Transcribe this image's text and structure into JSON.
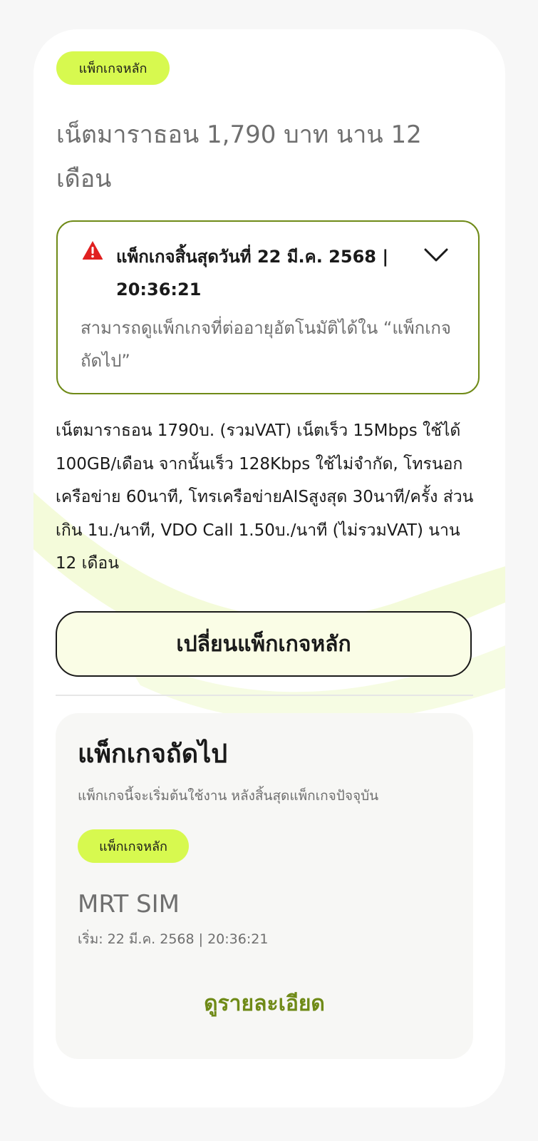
{
  "main_package": {
    "badge": "แพ็กเกจหลัก",
    "title": "เน็ตมาราธอน 1,790 บาท นาน 12 เดือน",
    "alert": {
      "title": "แพ็กเกจสิ้นสุดวันที่ 22 มี.ค. 2568 | 20:36:21",
      "description": "สามารถดูแพ็กเกจที่ต่ออายุอัตโนมัติได้ใน “แพ็กเกจถัดไป”"
    },
    "description": "เน็ตมาราธอน 1790บ. (รวมVAT) เน็ตเร็ว 15Mbps ใช้ได้ 100GB/เดือน จากนั้นเร็ว 128Kbps ใช้ไม่จำกัด, โทรนอกเครือข่าย 60นาที, โทรเครือข่ายAISสูงสุด 30นาที/ครั้ง ส่วนเกิน 1บ./นาที, VDO Call 1.50บ./นาที (ไม่รวมVAT) นาน 12 เดือน",
    "change_button": "เปลี่ยนแพ็กเกจหลัก"
  },
  "next_package": {
    "heading": "แพ็กเกจถัดไป",
    "subtitle": "แพ็กเกจนี้จะเริ่มต้นใช้งาน หลังสิ้นสุดแพ็กเกจปัจจุบัน",
    "badge": "แพ็กเกจหลัก",
    "name": "MRT SIM",
    "start": "เริ่ม: 22 มี.ค. 2568 | 20:36:21",
    "detail_link": "ดูรายละเอียด"
  },
  "colors": {
    "badge_bg": "#d7f94f",
    "accent_green": "#6f8a17",
    "warning_red": "#e02020"
  },
  "icons": {
    "warning": "warning-triangle-icon",
    "expand": "chevron-down-icon"
  }
}
